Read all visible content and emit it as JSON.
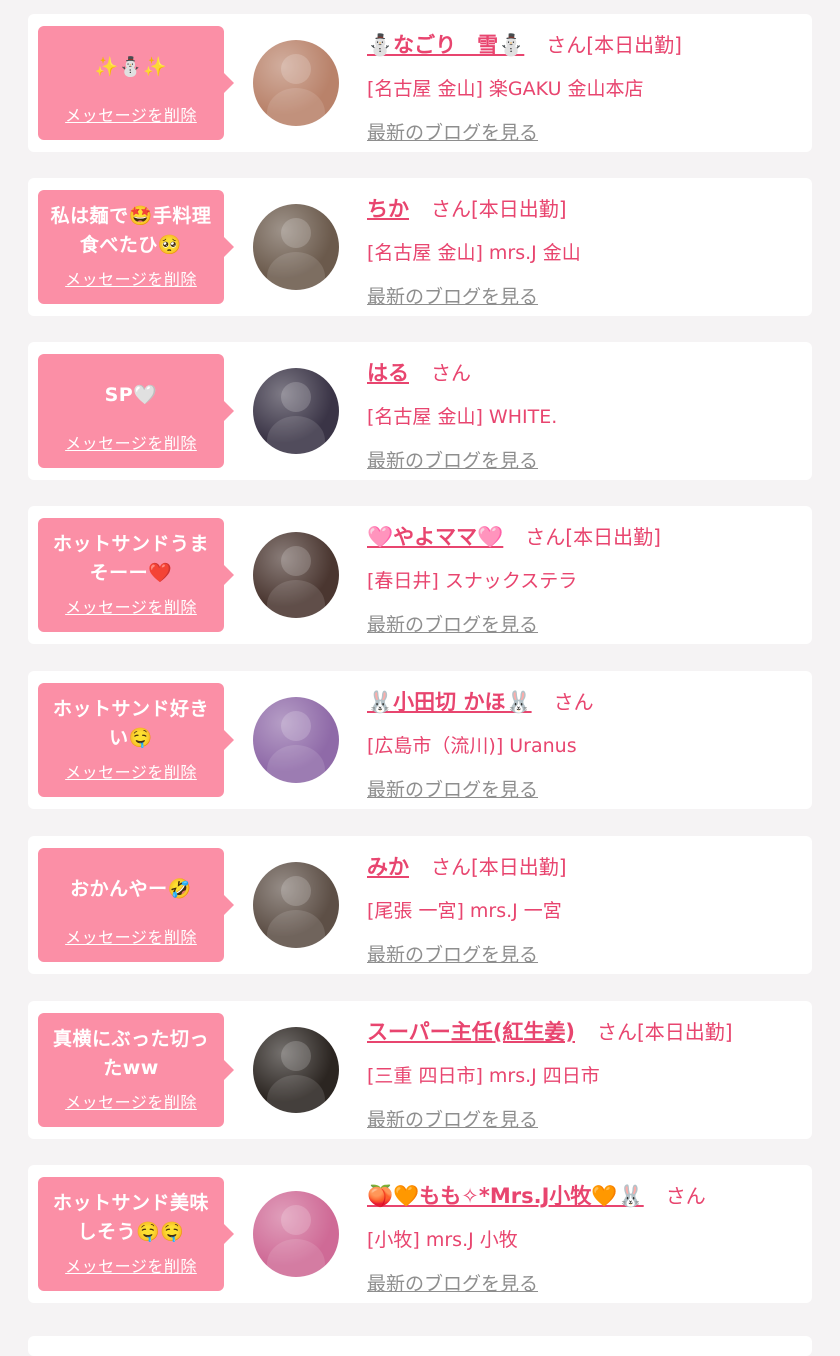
{
  "common": {
    "delete_label": "メッセージを削除",
    "blog_label": "最新のブログを見る"
  },
  "colors": {
    "background": "#f5f3f4",
    "card": "#ffffff",
    "bubble": "#fb8fa6",
    "accent": "#e8456f",
    "link_gray": "#8e8e8e"
  },
  "items": [
    {
      "message": "✨⛄✨",
      "name": "⛄なごり　雪⛄",
      "suffix": "さん[本日出勤]",
      "shop": "[名古屋 金山] 楽GAKU 金山本店",
      "avatar_color": "#b9826a",
      "avatar_icon": "woman-portrait-photo"
    },
    {
      "message": "私は麺で🤩手料理食べたひ🥺",
      "name": "ちか",
      "suffix": "さん[本日出勤]",
      "shop": "[名古屋 金山] mrs.J 金山",
      "avatar_color": "#6b5a4c",
      "avatar_icon": "woman-portrait-photo"
    },
    {
      "message": "SP🤍",
      "name": "はる",
      "suffix": "さん",
      "shop": "[名古屋 金山] WHITE.",
      "avatar_color": "#3a3446",
      "avatar_icon": "woman-portrait-photo"
    },
    {
      "message": "ホットサンドうまそーー❤️",
      "name": "🩷やよママ🩷",
      "suffix": "さん[本日出勤]",
      "shop": "[春日井] スナックステラ",
      "avatar_color": "#4a3630",
      "avatar_icon": "woman-portrait-photo"
    },
    {
      "message": "ホットサンド好きい🤤",
      "name": "🐰小田切 かほ🐰",
      "suffix": "さん",
      "shop": "[広島市（流川)] Uranus",
      "avatar_color": "#8f6aa8",
      "avatar_icon": "woman-portrait-photo"
    },
    {
      "message": "おかんやー🤣",
      "name": "みか",
      "suffix": "さん[本日出勤]",
      "shop": "[尾張 一宮] mrs.J 一宮",
      "avatar_color": "#5d4f46",
      "avatar_icon": "woman-portrait-photo"
    },
    {
      "message": "真横にぶった切ったww",
      "name": "スーパー主任(紅生姜)",
      "suffix": "さん[本日出勤]",
      "shop": "[三重 四日市] mrs.J 四日市",
      "avatar_color": "#2b2521",
      "avatar_icon": "man-portrait-photo"
    },
    {
      "message": "ホットサンド美味しそう🤤🤤",
      "name": "🍑🧡もも✧*Mrs.J小牧🧡🐰",
      "suffix": "さん",
      "shop": "[小牧] mrs.J 小牧",
      "avatar_color": "#cf6a96",
      "avatar_icon": "woman-portrait-photo"
    }
  ]
}
